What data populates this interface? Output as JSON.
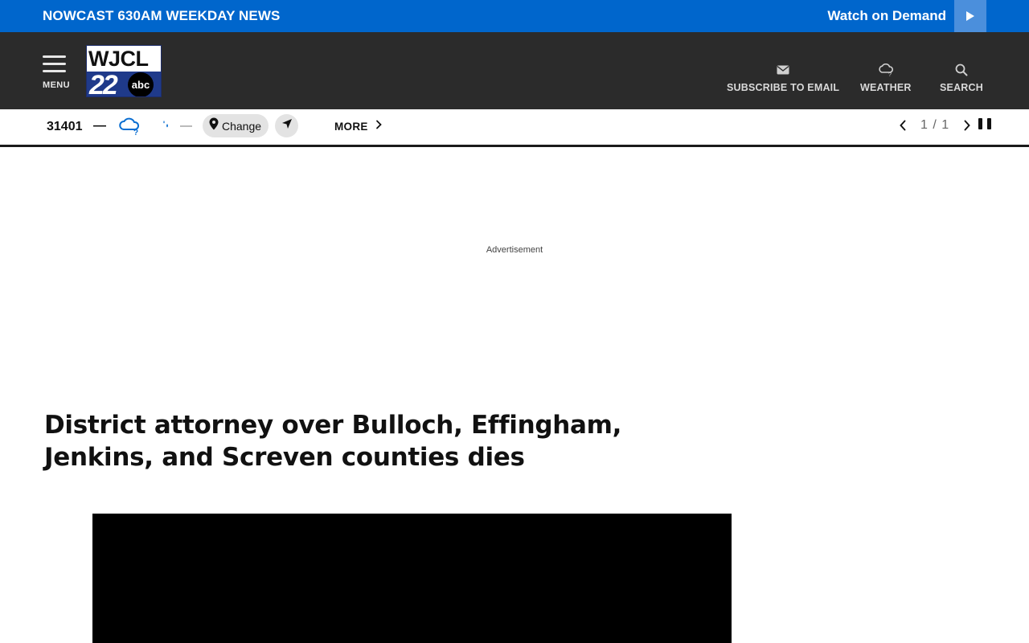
{
  "topbar": {
    "breaking_prefix": "NOWCAST ",
    "breaking_title": "630AM WEEKDAY NEWS",
    "watch_label": "Watch on Demand",
    "play_icon": "play-icon"
  },
  "header": {
    "menu_label": "MENU",
    "logo_call": "WJCL",
    "logo_number": "22",
    "logo_network": "abc",
    "nav": [
      {
        "label": "SUBSCRIBE TO EMAIL",
        "icon": "envelope-icon"
      },
      {
        "label": "WEATHER",
        "icon": "cloud-icon"
      },
      {
        "label": "SEARCH",
        "icon": "search-icon"
      }
    ]
  },
  "weather": {
    "zip": "31401",
    "temperature": "—",
    "precip": "—",
    "change_label": "Change",
    "more_label": "MORE",
    "pager": "1 / 1",
    "accent_color": "#0a6ed1"
  },
  "ad": {
    "label": "Advertisement"
  },
  "article": {
    "headline": "District attorney over Bulloch, Effingham, Jenkins, and Screven counties dies"
  }
}
